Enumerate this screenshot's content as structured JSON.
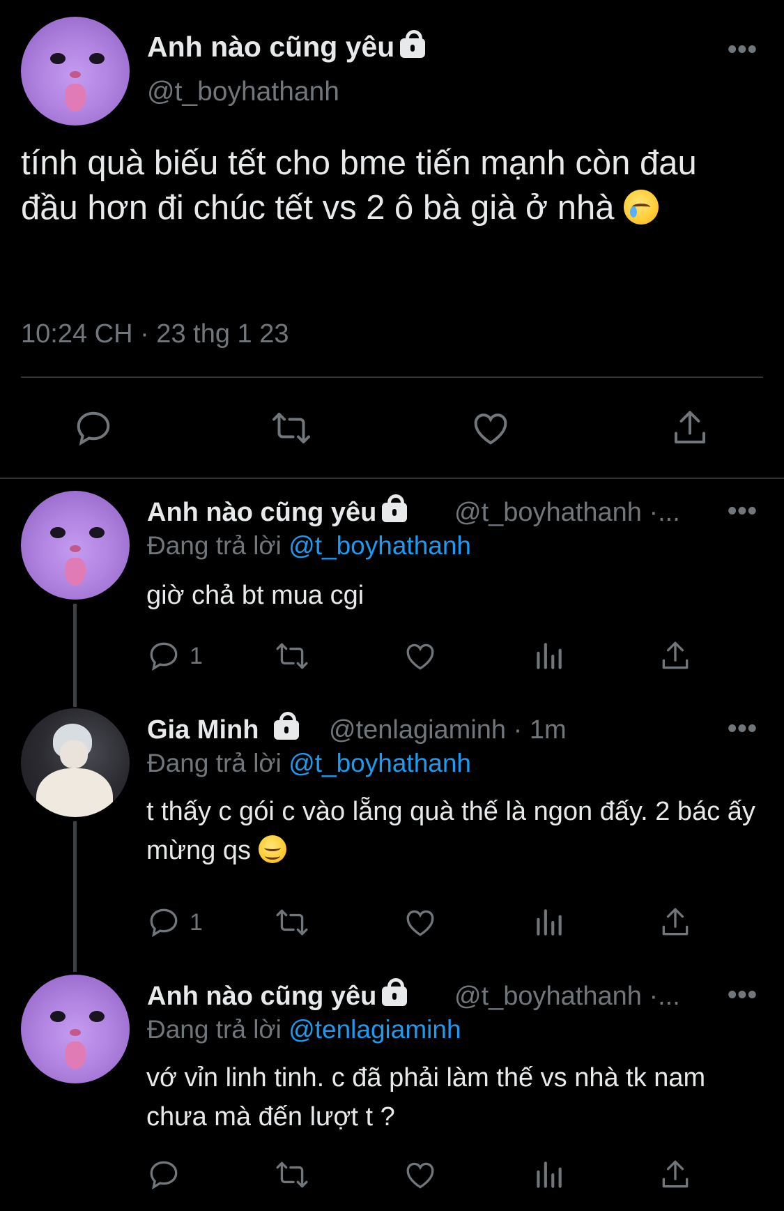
{
  "main_tweet": {
    "display_name": "Anh nào cũng yêu",
    "handle": "@t_boyhathanh",
    "text": "tính quà biếu tết cho bme tiến mạnh còn đau đầu hơn đi chúc tết vs 2 ô bà già ở nhà",
    "timestamp": "10:24 CH · 23 thg 1 23",
    "more_label": "•••"
  },
  "replies": [
    {
      "display_name": "Anh nào cũng yêu",
      "handle": "@t_boyhathanh ·...",
      "replying_prefix": "Đang trả lời",
      "replying_to": "@t_boyhathanh",
      "text": "giờ chả bt mua cgi",
      "reply_count": "1",
      "more_label": "•••"
    },
    {
      "display_name": "Gia Minh",
      "handle": "@tenlagiaminh · 1m",
      "replying_prefix": "Đang trả lời",
      "replying_to": "@t_boyhathanh",
      "text": "t thấy c gói c vào lẵng quà thế là ngon đấy. 2 bác ấy mừng qs",
      "reply_count": "1",
      "more_label": "•••"
    },
    {
      "display_name": "Anh nào cũng yêu",
      "handle": "@t_boyhathanh ·...",
      "replying_prefix": "Đang trả lời",
      "replying_to": "@tenlagiaminh",
      "text": "vớ vỉn linh tinh. c đã phải làm thế vs nhà tk nam chưa mà đến lượt t ?",
      "reply_count": "",
      "more_label": "•••"
    }
  ],
  "icons": [
    "reply-icon",
    "retweet-icon",
    "like-icon",
    "share-icon",
    "analytics-icon",
    "lock-icon",
    "more-icon"
  ],
  "colors": {
    "background": "#000000",
    "text": "#e7e9ea",
    "muted": "#71767b",
    "accent": "#1d9bf0"
  }
}
